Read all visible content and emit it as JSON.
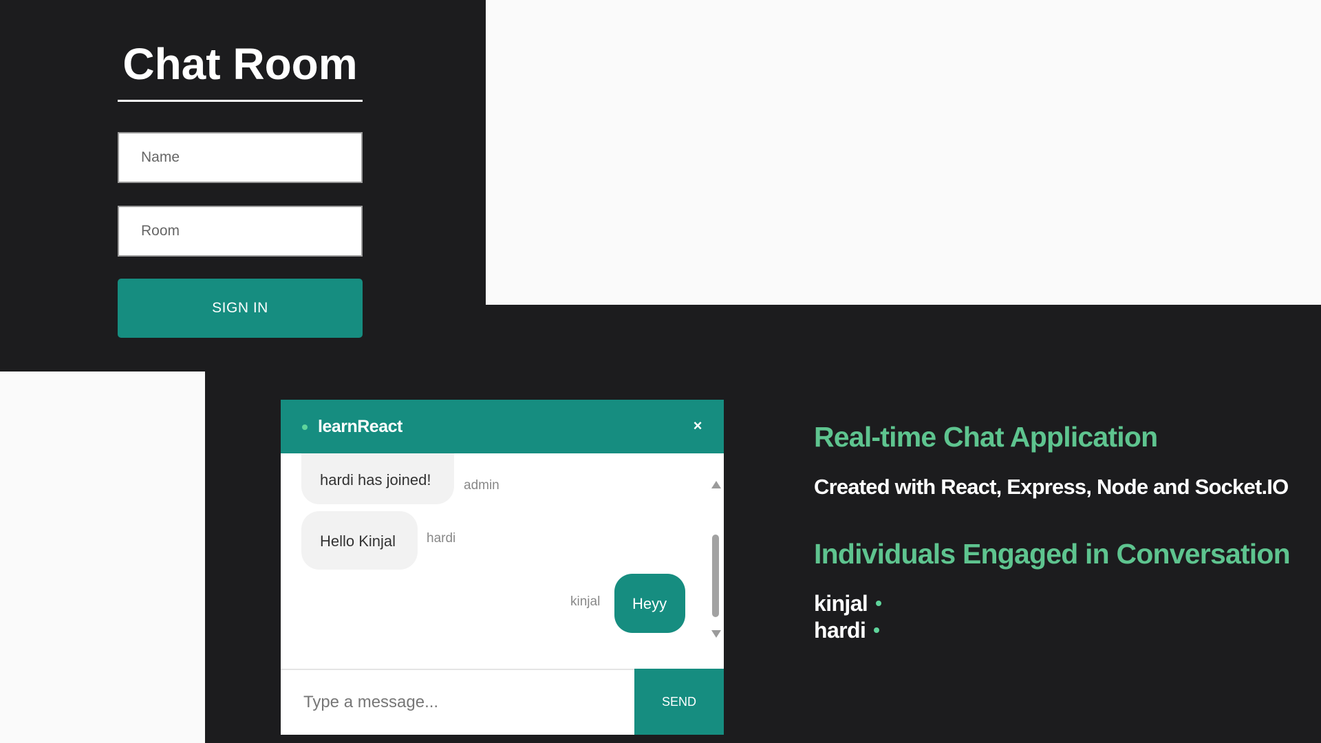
{
  "login": {
    "title": "Chat Room",
    "name_placeholder": "Name",
    "room_placeholder": "Room",
    "signin_label": "SIGN IN"
  },
  "chat": {
    "room_name": "learnReact",
    "close_icon": "×",
    "messages": [
      {
        "text": "hardi has joined!",
        "sender": "admin"
      },
      {
        "text": "Hello Kinjal",
        "sender": "hardi"
      },
      {
        "text": "Heyy",
        "sender": "kinjal"
      }
    ],
    "input_placeholder": "Type a message...",
    "send_label": "SEND"
  },
  "info": {
    "title": "Real-time Chat Application",
    "subtitle": "Created with React, Express, Node and Socket.IO",
    "users_heading": "Individuals Engaged in Conversation",
    "users": [
      {
        "name": "kinjal"
      },
      {
        "name": "hardi"
      }
    ]
  },
  "colors": {
    "background": "#1c1c1e",
    "accent": "#168d80",
    "heading_green": "#5ec48f",
    "online_dot": "#5fd49b"
  }
}
